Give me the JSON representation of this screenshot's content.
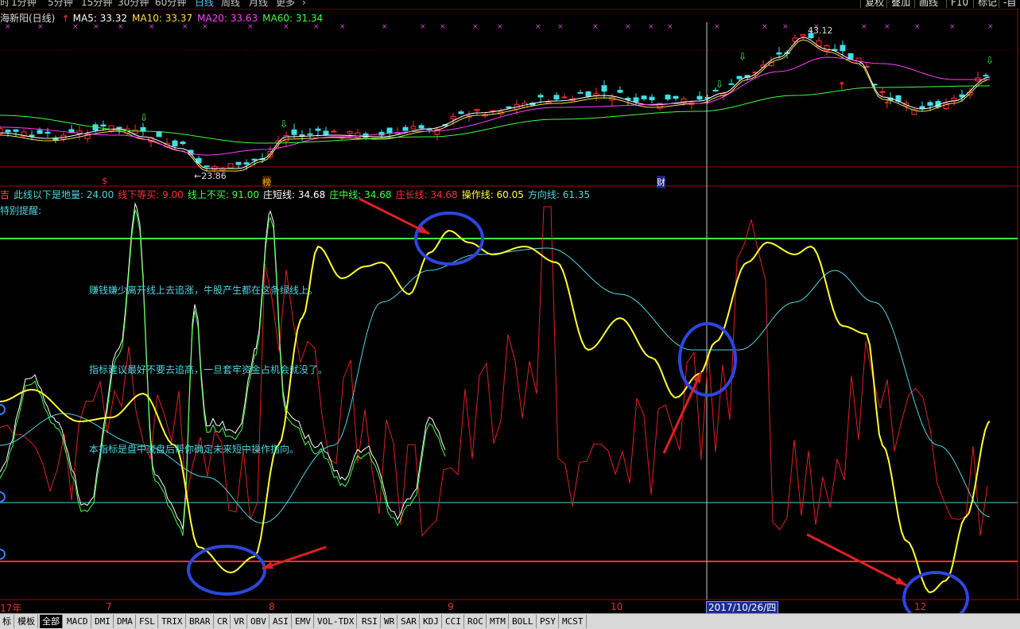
{
  "toolbar": {
    "periods": [
      "时",
      "1分钟",
      "5分钟",
      "15分钟",
      "30分钟",
      "60分钟",
      "日线",
      "周线",
      "月线",
      "更多"
    ],
    "active_period": "日线",
    "buttons": [
      "复权",
      "叠加",
      "画线",
      "F10",
      "标记",
      "-自"
    ]
  },
  "price_panel": {
    "stock_name": "海新阳(日线)",
    "ma": [
      {
        "label": "MA5: 33.32",
        "color": "#ffffff"
      },
      {
        "label": "MA10: 33.37",
        "color": "#ffe040"
      },
      {
        "label": "MA20: 33.63",
        "color": "#ff40ff"
      },
      {
        "label": "MA60: 31.34",
        "color": "#40ff40"
      }
    ],
    "high_label": "43.12",
    "low_label": "23.86",
    "event_tags": [
      {
        "text": "$",
        "color": "#ff3030"
      },
      {
        "text": "榜",
        "color": "#ffb000"
      },
      {
        "text": "财",
        "color": "#ffffff"
      }
    ]
  },
  "indicator_panel": {
    "legend": [
      {
        "label": "吉",
        "color": "#ff5050"
      },
      {
        "label": "此线以下是地量: 24.00",
        "color": "#4fd5e0"
      },
      {
        "label": "线下等买: 9.00",
        "color": "#ff3030"
      },
      {
        "label": "线上不买: 91.00",
        "color": "#40ff40"
      },
      {
        "label": "庄短线: 34.68",
        "color": "#ffffff"
      },
      {
        "label": "庄中线: 34.68",
        "color": "#40ff40"
      },
      {
        "label": "庄长线: 34.68",
        "color": "#ff3030"
      },
      {
        "label": "操作线: 60.05",
        "color": "#ffff40"
      },
      {
        "label": "方向线: 61.35",
        "color": "#4fd5e0"
      }
    ],
    "hint": "特别提醒:",
    "notes": [
      "赚钱嫌少离开线上去追涨，牛股产生都在这条绿线上。",
      "指标建议最好不要去追高，一旦套牢资金占机会就没了。",
      "本指标是盘中或盘后帮你确定未来短中操作指向。"
    ]
  },
  "x_axis": {
    "labels": [
      "17年",
      "7",
      "8",
      "9",
      "10",
      "12"
    ],
    "cursor_date": "2017/10/26/四"
  },
  "bottom_tabs": [
    "标",
    "模板",
    "全部",
    "MACD",
    "DMI",
    "DMA",
    "FSL",
    "TRIX",
    "BRAR",
    "CR",
    "VR",
    "OBV",
    "ASI",
    "EMV",
    "VOL-TDX",
    "RSI",
    "WR",
    "SAR",
    "KDJ",
    "CCI",
    "ROC",
    "MTM",
    "BOLL",
    "PSY",
    "MCST"
  ],
  "active_tab": "全部"
}
